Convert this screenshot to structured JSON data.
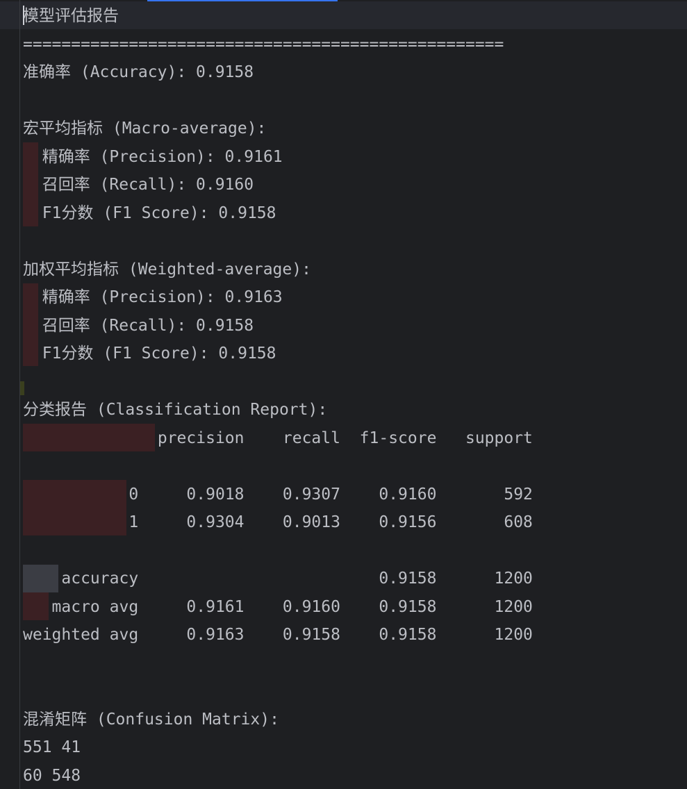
{
  "editor": {
    "lines": [
      "模型评估报告",
      "==================================================",
      "准确率 (Accuracy): 0.9158",
      "",
      "宏平均指标 (Macro-average):",
      "  精确率 (Precision): 0.9161",
      "  召回率 (Recall): 0.9160",
      "  F1分数 (F1 Score): 0.9158",
      "",
      "加权平均指标 (Weighted-average):",
      "  精确率 (Precision): 0.9163",
      "  召回率 (Recall): 0.9158",
      "  F1分数 (F1 Score): 0.9158",
      "",
      "分类报告 (Classification Report):",
      "              precision    recall  f1-score   support",
      "",
      "           0     0.9018    0.9307    0.9160       592",
      "           1     0.9304    0.9013    0.9156       608",
      "",
      "    accuracy                         0.9158      1200",
      "   macro avg     0.9161    0.9160    0.9158      1200",
      "weighted avg     0.9163    0.9158    0.9158      1200",
      "",
      "",
      "混淆矩阵 (Confusion Matrix):",
      "551 41",
      "60 548"
    ]
  }
}
